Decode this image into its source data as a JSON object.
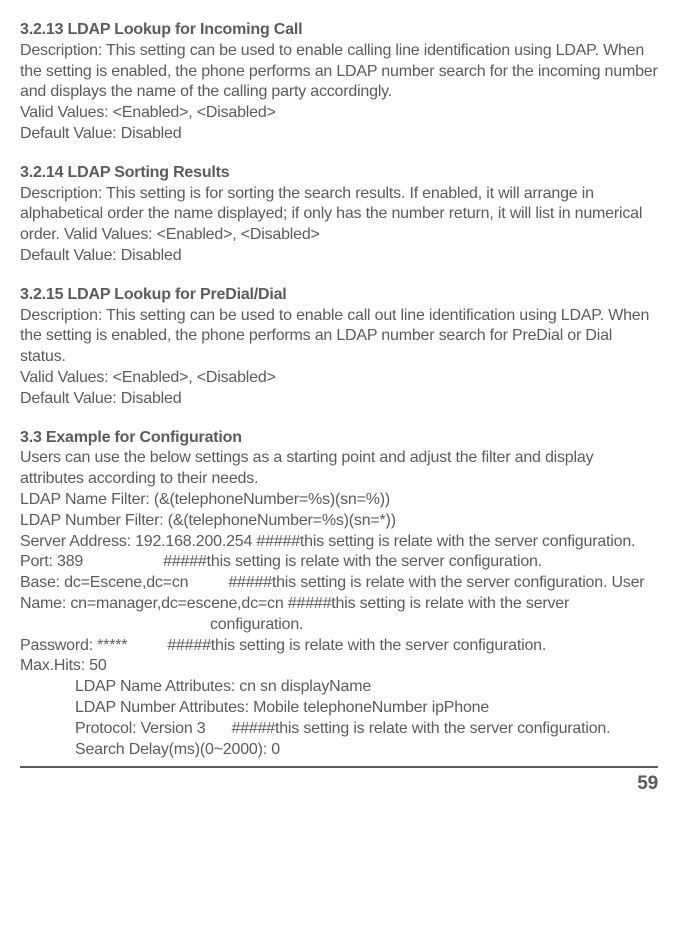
{
  "sections": {
    "s1": {
      "heading": "3.2.13  LDAP Lookup for Incoming Call",
      "body": "Description:  This setting can be used to enable calling line identification using LDAP.  When the setting is enabled, the phone performs an LDAP number search for the incoming number and displays the name of the calling party accordingly.",
      "valid": "Valid Values: <Enabled>, <Disabled>",
      "default": "Default Value: Disabled"
    },
    "s2": {
      "heading": "3.2.14  LDAP Sorting Results",
      "body": "Description: This setting is for sorting the search results.  If enabled, it will arrange in alphabetical order the name displayed; if only has the number return, it will list in numerical order. Valid Values: <Enabled>, <Disabled>",
      "default": "Default Value: Disabled"
    },
    "s3": {
      "heading": "3.2.15  LDAP Lookup for PreDial/Dial",
      "body": "Description: This setting can be used to enable call out line identification using LDAP. When the setting is enabled, the phone performs an LDAP number search for PreDial or Dial status.",
      "valid": "Valid Values: <Enabled>, <Disabled>",
      "default": "Default Value: Disabled"
    },
    "s4": {
      "heading": "3.3  Example for Configuration",
      "intro": "Users can use the below settings as a starting point and adjust the filter and display attributes according to their needs.",
      "l1": "LDAP Name Filter: (&(telephoneNumber=%s)(sn=%))",
      "l2": "LDAP Number Filter: (&(telephoneNumber=%s)(sn=*))",
      "l3": "Server Address: 192.168.200.254  #####this setting is relate with the server configuration.",
      "l4a": "Port: 389",
      "l4b": "#####this setting is relate with the server configuration.",
      "l5a": "Base: dc=Escene,dc=cn",
      "l5b": "#####this setting is relate with the server configuration. User Name: cn=manager,dc=escene,dc=cn    #####this setting is relate with the server",
      "l5c": "configuration.",
      "l6a": "Password: *****",
      "l6b": "#####this setting is relate with the server configuration.",
      "l7": "Max.Hits: 50",
      "i1": "LDAP Name Attributes: cn sn displayName",
      "i2": "LDAP Number Attributes: Mobile telephoneNumber ipPhone",
      "i3a": "Protocol: Version 3",
      "i3b": "#####this setting is relate with the server configuration.",
      "i4": "Search Delay(ms)(0~2000): 0"
    }
  },
  "pageNumber": "59"
}
